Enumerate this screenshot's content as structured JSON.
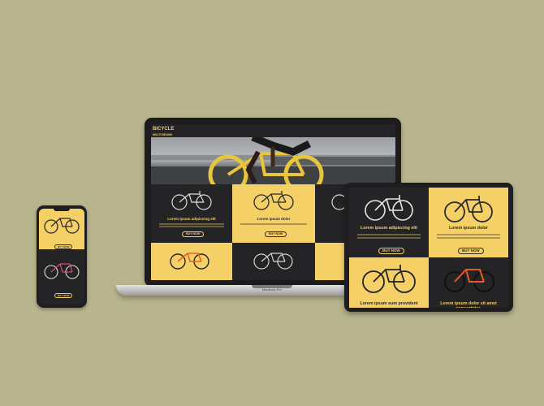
{
  "laptop": {
    "model_label": "MacBook Pro",
    "site": {
      "brand_title": "BICYCLE",
      "brand_sub": "MULTI BRAND"
    },
    "cards": [
      {
        "title": "Lorem ipsum adipiscing elit",
        "button": "BUY NOW",
        "theme": "dark"
      },
      {
        "title": "Lorem ipsum dolor",
        "button": "BUY NOW",
        "theme": "yellow"
      },
      {
        "title": "",
        "button": "",
        "theme": "dark"
      },
      {
        "title": "",
        "button": "",
        "theme": "yellow"
      },
      {
        "title": "",
        "button": "",
        "theme": "dark"
      },
      {
        "title": "",
        "button": "",
        "theme": "yellow"
      }
    ]
  },
  "tablet": {
    "cards": [
      {
        "title": "Lorem ipsum adipiscing elit",
        "button": "BUY NOW",
        "theme": "dark"
      },
      {
        "title": "Lorem ipsum dolor",
        "button": "BUY NOW",
        "theme": "yellow"
      },
      {
        "title": "Lorem ipsum eum provident",
        "button": "",
        "theme": "yellow"
      },
      {
        "title": "Lorem ipsum dolor sit amet consectetur.",
        "button": "",
        "theme": "dark"
      }
    ]
  },
  "phone": {
    "buttons": [
      "BUY NOW",
      "BUY NOW"
    ]
  },
  "colors": {
    "background": "#b8b48d",
    "accent_yellow": "#f5d067",
    "dark_panel": "#242426"
  }
}
